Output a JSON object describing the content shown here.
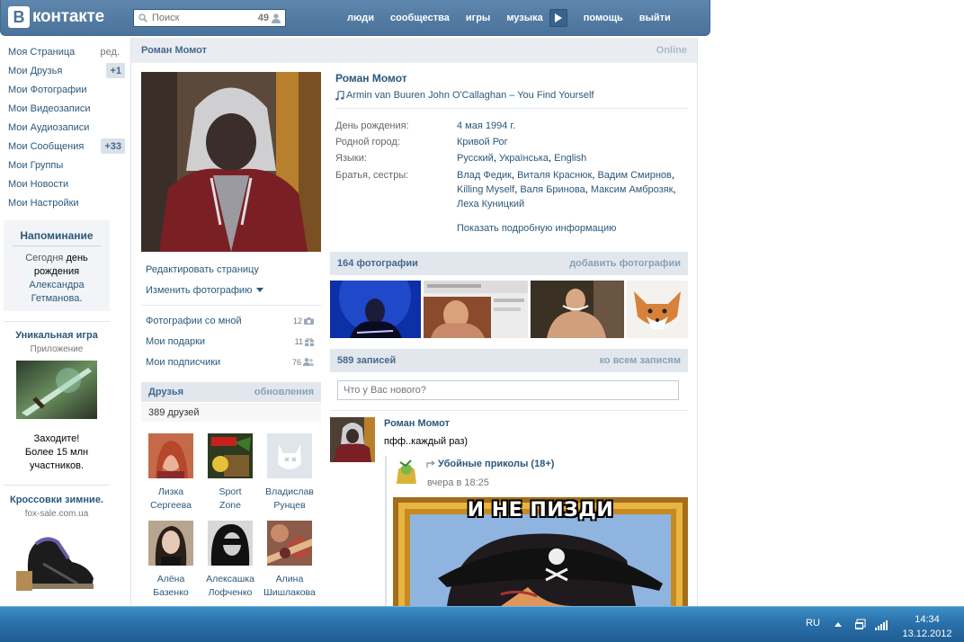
{
  "header": {
    "logo_letter": "В",
    "logo_word": "контакте",
    "search_placeholder": "Поиск",
    "search_count": "49",
    "nav": [
      "люди",
      "сообщества",
      "игры",
      "музыка",
      "помощь",
      "выйти"
    ]
  },
  "left_nav": {
    "items": [
      {
        "label": "Моя Страница",
        "extra": "ред."
      },
      {
        "label": "Мои Друзья",
        "badge": "+1"
      },
      {
        "label": "Мои Фотографии"
      },
      {
        "label": "Мои Видеозаписи"
      },
      {
        "label": "Мои Аудиозаписи"
      },
      {
        "label": "Мои Сообщения",
        "badge": "+33"
      },
      {
        "label": "Мои Группы"
      },
      {
        "label": "Мои Новости"
      },
      {
        "label": "Мои Настройки"
      }
    ],
    "reminder": {
      "title": "Напоминание",
      "pre": "Сегодня",
      "mid": "день рождения",
      "name_first": "Александра",
      "name_last": "Гетманова",
      "suffix": "."
    },
    "ads": [
      {
        "title": "Уникальная игра",
        "subtitle": "Приложение",
        "line1": "Заходите!",
        "line2": "Более 15 млн",
        "line3": "участников."
      },
      {
        "title": "Кроссовки зимние.",
        "subtitle": "fox-sale.com.ua"
      }
    ]
  },
  "profile": {
    "header_name": "Роман Момот",
    "online": "Online",
    "name": "Роман Момот",
    "status": "Armin van Buuren John O'Callaghan – You Find Yourself",
    "info": {
      "birthday_label": "День рождения:",
      "birthday_value": "4 мая 1994 г.",
      "city_label": "Родной город:",
      "city_value": "Кривой Рог",
      "lang_label": "Языки:",
      "lang_1": "Русский",
      "lang_2": "Українська",
      "lang_3": "English",
      "siblings_label": "Братья, сестры:",
      "siblings": [
        "Влад Федик",
        "Виталя Краснюк",
        "Вадим Смирнов",
        "Killing Myself",
        "Валя Бринова",
        "Максим Амброзяк",
        "Леха Куницкий"
      ],
      "more": "Показать подробную информацию"
    },
    "actions": {
      "edit": "Редактировать страницу",
      "change_photo": "Изменить фотографию"
    },
    "counters": [
      {
        "label": "Фотографии со мной",
        "count": "12"
      },
      {
        "label": "Мои подарки",
        "count": "11"
      },
      {
        "label": "Мои подписчики",
        "count": "76"
      }
    ],
    "friends": {
      "title": "Друзья",
      "updates": "обновления",
      "count": "389 друзей",
      "list": [
        {
          "first": "Лизка",
          "last": "Сергеева"
        },
        {
          "first": "Sport",
          "last": "Zone"
        },
        {
          "first": "Владислав",
          "last": "Рунцев"
        },
        {
          "first": "Алёна",
          "last": "Базенко"
        },
        {
          "first": "Алексашка",
          "last": "Лофченко"
        },
        {
          "first": "Алина",
          "last": "Шишлакова"
        }
      ]
    },
    "photos": {
      "title": "164 фотографии",
      "add": "добавить фотографии"
    },
    "wall": {
      "title": "589 записей",
      "all": "ко всем записям",
      "input_placeholder": "Что у Вас нового?",
      "post": {
        "author": "Роман Момот",
        "text": "пфф..каждый раз)",
        "repost_group": "Убойные приколы (18+)",
        "repost_time": "вчера в 18:25",
        "image_caption": "И НЕ ПИЗДИ"
      }
    }
  },
  "taskbar": {
    "lang": "RU",
    "time": "14:34",
    "date": "13.12.2012"
  },
  "colors": {
    "brand": "#4a729a",
    "link": "#2b587a",
    "head_bg": "#e1e7ed"
  }
}
